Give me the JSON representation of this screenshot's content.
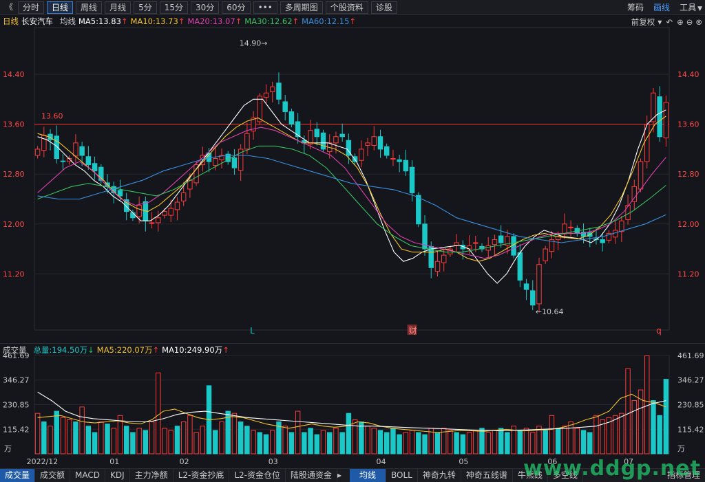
{
  "toolbar": {
    "collapse_label": "《",
    "buttons": [
      "分时",
      "日线",
      "周线",
      "月线",
      "5分",
      "15分",
      "30分",
      "60分",
      "•••",
      "多周期图",
      "个股资料",
      "诊股"
    ],
    "active_index": 1,
    "right": [
      "筹码",
      "画线",
      "工具"
    ],
    "right_active_index": 1
  },
  "ma_line": {
    "period": "日线",
    "stock": "长安汽车",
    "avg_label": "均线",
    "ma5": "MA5:13.83",
    "ma10": "MA10:13.73",
    "ma20": "MA20:13.07",
    "ma30": "MA30:12.62",
    "ma60": "MA60:12.15",
    "arrow": "↑",
    "adjust": "前复权"
  },
  "colors": {
    "up": "#ff3b3b",
    "down": "#1bc8c8",
    "ma5": "#ffffff",
    "ma10": "#f2c230",
    "ma20": "#e040b0",
    "ma30": "#38c060",
    "ma60": "#3a8ee0",
    "ref": "#c83030"
  },
  "chart_data": [
    {
      "type": "candlestick",
      "y_ticks": [
        "14.40",
        "13.60",
        "12.80",
        "12.00",
        "11.20"
      ],
      "ylim": [
        10.3,
        15.15
      ],
      "reference_line": {
        "value": 13.6,
        "label": "13.60"
      },
      "annotations": {
        "high": "14.90→",
        "low": "←10.64",
        "markers": [
          "L",
          "财",
          "q"
        ]
      },
      "x_labels": [
        "2022/12",
        "01",
        "02",
        "03",
        "04",
        "05",
        "06",
        "07"
      ],
      "x_label_index": [
        0,
        12,
        23,
        37,
        54,
        67,
        81,
        93
      ],
      "n": 100,
      "close": [
        13.2,
        13.42,
        13.35,
        13.05,
        13.0,
        13.05,
        13.3,
        13.1,
        12.95,
        12.85,
        12.7,
        12.6,
        12.5,
        12.45,
        12.2,
        12.1,
        12.3,
        12.05,
        12.02,
        12.1,
        12.2,
        12.25,
        12.35,
        12.5,
        12.7,
        12.95,
        13.1,
        13.0,
        13.05,
        13.1,
        13.0,
        12.9,
        13.2,
        13.45,
        13.7,
        14.05,
        14.1,
        14.2,
        14.0,
        13.8,
        13.6,
        13.4,
        13.3,
        13.5,
        13.4,
        13.2,
        13.3,
        13.4,
        13.4,
        13.1,
        13.0,
        13.2,
        13.3,
        13.4,
        13.2,
        13.1,
        13.05,
        13.0,
        12.85,
        12.5,
        12.0,
        11.6,
        11.3,
        11.4,
        11.5,
        11.6,
        11.7,
        11.6,
        11.65,
        11.7,
        11.6,
        11.65,
        11.75,
        11.7,
        11.8,
        11.5,
        11.1,
        10.95,
        10.7,
        11.35,
        11.6,
        11.75,
        11.8,
        12.0,
        11.95,
        11.85,
        11.8,
        11.8,
        11.75,
        11.7,
        11.85,
        11.9,
        12.05,
        12.3,
        12.6,
        13.0,
        13.6,
        14.1,
        13.4,
        13.95
      ],
      "series": [
        {
          "name": "MA5",
          "values": [
            13.4,
            13.35,
            13.25,
            13.1,
            12.95,
            12.85,
            12.7,
            12.6,
            12.45,
            12.35,
            12.2,
            12.05,
            12.05,
            12.15,
            12.3,
            12.5,
            12.7,
            12.9,
            13.1,
            13.3,
            13.5,
            13.7,
            13.9,
            14.0,
            14.0,
            13.8,
            13.6,
            13.5,
            13.4,
            13.3,
            13.3,
            13.3,
            13.25,
            13.2,
            13.0,
            12.7,
            12.3,
            11.9,
            11.55,
            11.4,
            11.45,
            11.55,
            11.6,
            11.62,
            11.64,
            11.66,
            11.6,
            11.4,
            11.2,
            11.05,
            11.2,
            11.45,
            11.65,
            11.8,
            11.9,
            11.85,
            11.8,
            11.78,
            11.76,
            11.7,
            11.8,
            12.0,
            12.3,
            12.7,
            13.2,
            13.6,
            13.75,
            13.83
          ]
        },
        {
          "name": "MA10",
          "values": [
            13.45,
            13.4,
            13.3,
            13.15,
            13.0,
            12.85,
            12.7,
            12.5,
            12.35,
            12.25,
            12.2,
            12.3,
            12.45,
            12.6,
            12.8,
            13.0,
            13.2,
            13.4,
            13.55,
            13.65,
            13.7,
            13.6,
            13.5,
            13.4,
            13.3,
            13.3,
            13.25,
            13.2,
            13.1,
            12.9,
            12.6,
            12.2,
            11.85,
            11.6,
            11.55,
            11.55,
            11.55,
            11.6,
            11.55,
            11.45,
            11.4,
            11.45,
            11.55,
            11.65,
            11.75,
            11.82,
            11.85,
            11.8,
            11.78,
            11.76,
            11.82,
            11.95,
            12.15,
            12.45,
            12.85,
            13.3,
            13.6,
            13.73
          ]
        },
        {
          "name": "MA20",
          "values": [
            12.5,
            12.7,
            12.9,
            13.0,
            12.85,
            12.6,
            12.4,
            12.3,
            12.35,
            12.5,
            12.7,
            12.9,
            13.1,
            13.3,
            13.4,
            13.5,
            13.55,
            13.5,
            13.4,
            13.3,
            13.2,
            13.1,
            12.9,
            12.6,
            12.3,
            12.0,
            11.8,
            11.7,
            11.65,
            11.6,
            11.55,
            11.5,
            11.45,
            11.5,
            11.6,
            11.7,
            11.8,
            11.85,
            11.85,
            11.85,
            11.9,
            12.0,
            12.2,
            12.5,
            12.8,
            13.07
          ]
        },
        {
          "name": "MA30",
          "values": [
            12.4,
            12.5,
            12.6,
            12.65,
            12.6,
            12.55,
            12.5,
            12.45,
            12.55,
            12.7,
            12.85,
            13.0,
            13.15,
            13.25,
            13.25,
            13.2,
            13.1,
            12.9,
            12.6,
            12.3,
            12.0,
            11.8,
            11.65,
            11.6,
            11.55,
            11.55,
            11.6,
            11.65,
            11.7,
            11.75,
            11.8,
            11.85,
            11.9,
            11.95,
            12.05,
            12.2,
            12.4,
            12.62
          ]
        },
        {
          "name": "MA60",
          "values": [
            12.45,
            12.4,
            12.4,
            12.5,
            12.6,
            12.7,
            12.85,
            12.95,
            13.05,
            13.1,
            13.1,
            13.05,
            12.95,
            12.85,
            12.75,
            12.65,
            12.6,
            12.55,
            12.45,
            12.3,
            12.1,
            12.0,
            11.9,
            11.8,
            11.75,
            11.7,
            11.75,
            11.8,
            11.9,
            12.0,
            12.15
          ]
        }
      ]
    },
    {
      "type": "bar",
      "title": "成交量",
      "total": "总量:194.50万",
      "total_arrow": "↓",
      "ma5": "MA5:220.07万",
      "ma10": "MA10:249.90万",
      "ma_arrow": "↑",
      "y_ticks": [
        "461.69",
        "346.27",
        "230.85",
        "115.42"
      ],
      "unit": "万",
      "ylim": [
        0,
        461.69
      ],
      "values": [
        190,
        150,
        130,
        200,
        170,
        160,
        150,
        220,
        130,
        100,
        150,
        140,
        120,
        180,
        130,
        100,
        120,
        110,
        150,
        380,
        120,
        110,
        130,
        150,
        180,
        100,
        130,
        320,
        110,
        150,
        200,
        190,
        150,
        130,
        110,
        100,
        90,
        110,
        150,
        130,
        100,
        200,
        100,
        120,
        90,
        110,
        100,
        120,
        100,
        190,
        160,
        150,
        130,
        120,
        110,
        100,
        120,
        90,
        100,
        110,
        100,
        90,
        120,
        100,
        120,
        110,
        100,
        90,
        100,
        110,
        120,
        100,
        110,
        120,
        100,
        130,
        110,
        120,
        100,
        130,
        110,
        180,
        120,
        130,
        150,
        120,
        110,
        100,
        180,
        160,
        170,
        180,
        190,
        400,
        250,
        300,
        460,
        250,
        180,
        350,
        190
      ],
      "up": [
        1,
        0,
        1,
        0,
        1,
        1,
        0,
        1,
        0,
        0,
        1,
        0,
        1,
        1,
        0,
        0,
        1,
        0,
        1,
        1,
        1,
        1,
        0,
        1,
        1,
        1,
        1,
        0,
        0,
        1,
        0,
        1,
        0,
        0,
        1,
        0,
        0,
        1,
        0,
        1,
        0,
        1,
        0,
        0,
        0,
        1,
        0,
        1,
        0,
        0,
        1,
        0,
        1,
        1,
        0,
        0,
        0,
        0,
        1,
        1,
        0,
        0,
        1,
        0,
        1,
        1,
        0,
        0,
        1,
        1,
        0,
        1,
        1,
        0,
        0,
        1,
        0,
        1,
        1,
        1,
        0,
        1,
        0,
        1,
        1,
        1,
        0,
        0,
        1,
        1,
        1,
        1,
        1,
        1,
        1,
        1,
        1,
        0,
        0,
        0,
        0
      ],
      "series": [
        {
          "name": "MA5",
          "values": [
            170,
            175,
            180,
            165,
            150,
            145,
            150,
            155,
            145,
            140,
            160,
            200,
            210,
            190,
            170,
            160,
            165,
            175,
            170,
            155,
            140,
            130,
            120,
            130,
            140,
            130,
            125,
            130,
            150,
            145,
            130,
            120,
            115,
            110,
            105,
            100,
            105,
            110,
            108,
            105,
            110,
            115,
            110,
            108,
            112,
            115,
            125,
            140,
            160,
            175,
            200,
            260,
            280,
            250,
            240,
            220
          ]
        },
        {
          "name": "MA10",
          "values": [
            290,
            250,
            200,
            175,
            165,
            160,
            155,
            150,
            150,
            165,
            185,
            195,
            200,
            190,
            180,
            170,
            165,
            160,
            155,
            150,
            145,
            140,
            135,
            130,
            130,
            128,
            125,
            122,
            120,
            118,
            115,
            112,
            110,
            108,
            110,
            112,
            115,
            118,
            120,
            125,
            130,
            150,
            180,
            210,
            235,
            250
          ]
        }
      ]
    }
  ],
  "volume_x_labels": [
    "2022/12",
    "01",
    "02",
    "03",
    "04",
    "05",
    "06",
    "07"
  ],
  "bottom_tabs": [
    "成交量",
    "成交额",
    "MACD",
    "KDJ",
    "主力净额",
    "L2-资金抄底",
    "L2-资金仓位",
    "陆股通资金",
    "均线",
    "BOLL",
    "神奇九转",
    "神奇五线谱",
    "牛熊线",
    "多空线",
    "指标管理"
  ],
  "bottom_active": [
    0,
    8
  ],
  "watermark": "www.ddgp.net"
}
